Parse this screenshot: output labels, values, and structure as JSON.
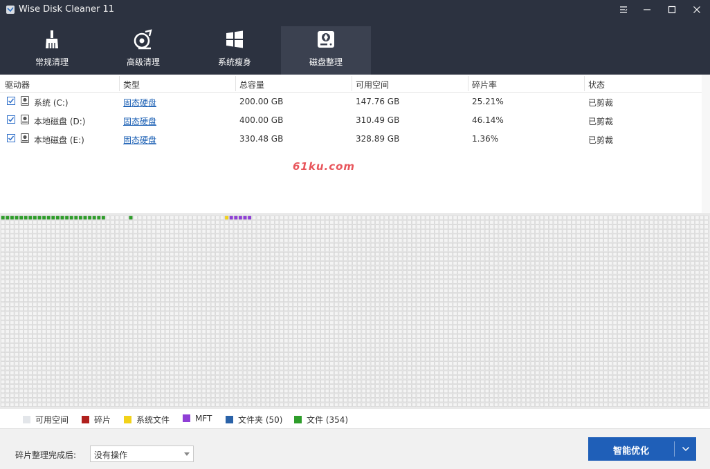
{
  "window": {
    "title": "Wise Disk Cleaner 11"
  },
  "nav": {
    "items": [
      {
        "label": "常规清理",
        "icon": "broom-icon"
      },
      {
        "label": "高级清理",
        "icon": "advanced-clean-icon"
      },
      {
        "label": "系统瘦身",
        "icon": "windows-logo-icon"
      },
      {
        "label": "磁盘整理",
        "icon": "disk-defrag-icon"
      }
    ],
    "active_index": 3
  },
  "table": {
    "headers": [
      "驱动器",
      "类型",
      "总容量",
      "可用空间",
      "碎片率",
      "状态"
    ],
    "rows": [
      {
        "drive": "系统 (C:)",
        "type": "固态硬盘",
        "total": "200.00 GB",
        "free": "147.76 GB",
        "frag": "25.21%",
        "status": "已剪裁",
        "checked": true
      },
      {
        "drive": "本地磁盘 (D:)",
        "type": "固态硬盘",
        "total": "400.00 GB",
        "free": "310.49 GB",
        "frag": "46.14%",
        "status": "已剪裁",
        "checked": true
      },
      {
        "drive": "本地磁盘 (E:)",
        "type": "固态硬盘",
        "total": "330.48 GB",
        "free": "328.89 GB",
        "frag": "1.36%",
        "status": "已剪裁",
        "checked": true
      }
    ]
  },
  "watermark": "61ku.com",
  "legend": [
    {
      "label": "可用空间",
      "color": "#e3e6ea"
    },
    {
      "label": "碎片",
      "color": "#b0201d"
    },
    {
      "label": "系统文件",
      "color": "#f2d21a"
    },
    {
      "label": "MFT",
      "color": "#8f3fd6"
    },
    {
      "label": "文件夹 (50)",
      "color": "#2a62a8"
    },
    {
      "label": "文件 (354)",
      "color": "#2e9d2a"
    }
  ],
  "bottom": {
    "after_label": "碎片整理完成后:",
    "after_value": "没有操作",
    "primary_label": "智能优化"
  },
  "colors": {
    "topbar": "#2c3240",
    "nav_active": "#3b4150",
    "accent": "#1f5fb8",
    "link": "#1a5fb4",
    "file": "#2e9d2a",
    "system_file": "#f2d21a",
    "mft": "#8f3fd6",
    "free_cell": "#f4f4f4"
  }
}
